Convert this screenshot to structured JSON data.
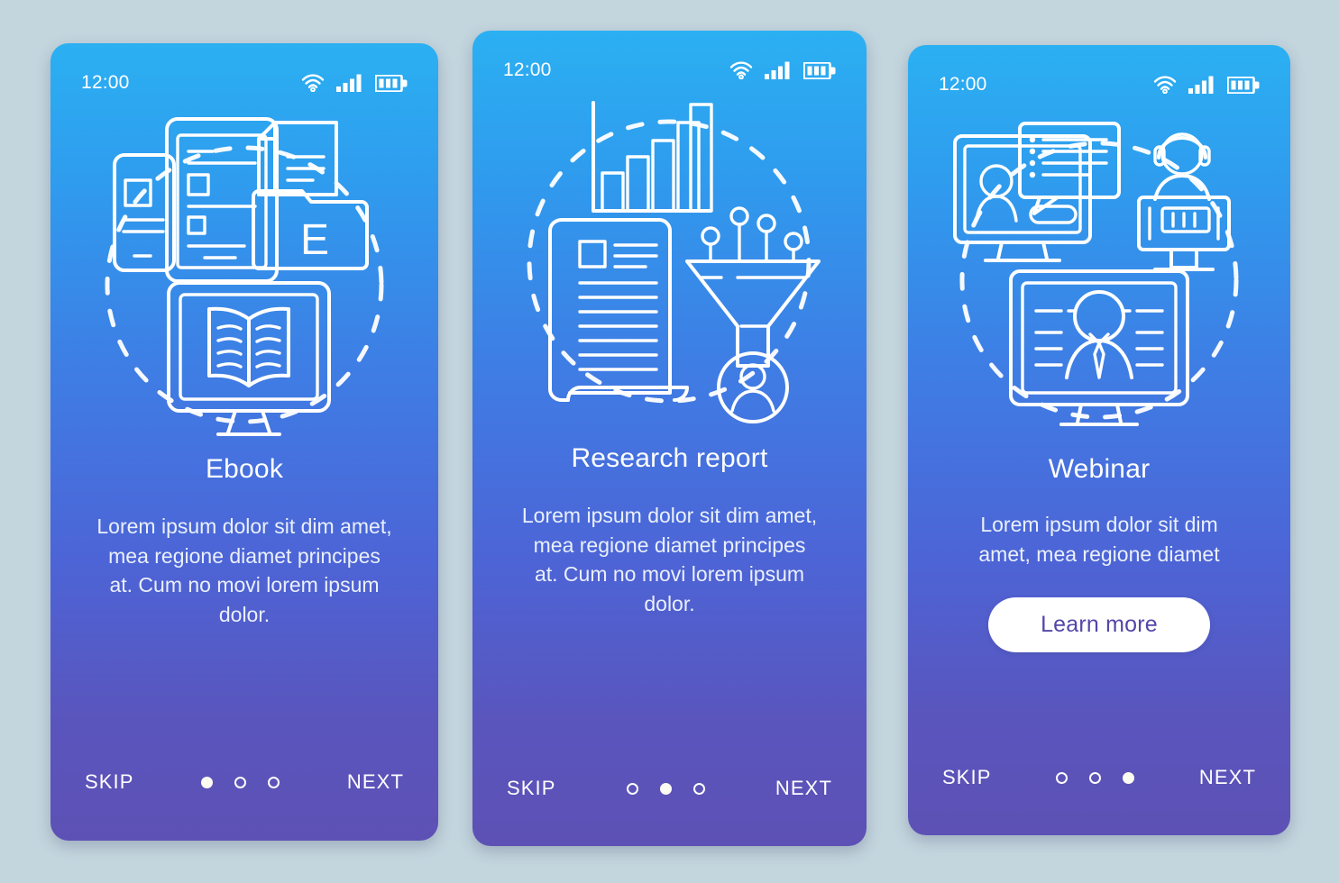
{
  "background_color": "#c3d5dd",
  "screens": [
    {
      "id": "ebook",
      "status": {
        "time": "12:00",
        "wifi_icon": "wifi-icon",
        "signal_icon": "signal-bars-icon",
        "battery_icon": "battery-icon"
      },
      "illustration_name": "ebook-illustration",
      "title": "Ebook",
      "body": "Lorem ipsum dolor sit dim amet, mea regione diamet principes at. Cum no movi lorem ipsum dolor.",
      "cta": null,
      "nav": {
        "skip_label": "SKIP",
        "next_label": "NEXT",
        "dots": 3,
        "active_dot": 0
      }
    },
    {
      "id": "research-report",
      "status": {
        "time": "12:00",
        "wifi_icon": "wifi-icon",
        "signal_icon": "signal-bars-icon",
        "battery_icon": "battery-icon"
      },
      "illustration_name": "research-report-illustration",
      "title": "Research report",
      "body": "Lorem ipsum dolor sit dim amet, mea regione diamet principes at. Cum no movi lorem ipsum dolor.",
      "cta": null,
      "nav": {
        "skip_label": "SKIP",
        "next_label": "NEXT",
        "dots": 3,
        "active_dot": 1
      }
    },
    {
      "id": "webinar",
      "status": {
        "time": "12:00",
        "wifi_icon": "wifi-icon",
        "signal_icon": "signal-bars-icon",
        "battery_icon": "battery-icon"
      },
      "illustration_name": "webinar-illustration",
      "title": "Webinar",
      "body": "Lorem ipsum dolor sit dim amet, mea regione diamet",
      "cta": {
        "label": "Learn more",
        "background": "#ffffff",
        "text_color": "#5346a8"
      },
      "nav": {
        "skip_label": "SKIP",
        "next_label": "NEXT",
        "dots": 3,
        "active_dot": 2
      }
    }
  ],
  "theme": {
    "gradient_top": "#2bb0f2",
    "gradient_bottom": "#5d51b5",
    "line_art_color": "#ffffff"
  }
}
